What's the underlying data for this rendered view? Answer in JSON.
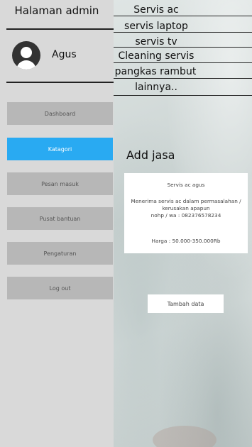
{
  "sidebar": {
    "title": "Halaman admin",
    "user_name": "Agus",
    "buttons": [
      {
        "label": "Dashboard"
      },
      {
        "label": "Katagori"
      },
      {
        "label": "Pesan masuk"
      },
      {
        "label": "Pusat bantuan"
      },
      {
        "label": "Pengaturan"
      },
      {
        "label": "Log out"
      }
    ],
    "active_index": 1
  },
  "category_menu": [
    "Servis ac",
    "servis laptop",
    "servis tv",
    "Cleaning servis",
    "pangkas rambut",
    "lainnya.."
  ],
  "main": {
    "heading": "Add jasa",
    "card": {
      "name": "Servis ac agus",
      "desc_line1": "Menerima servis ac dalam permasalahan /",
      "desc_line2": "kerusakan apapun",
      "contact": "nohp / wa : 082376578234",
      "price": "Harga : 50.000-350.000Rb"
    },
    "add_button_label": "Tambah data"
  },
  "colors": {
    "sidebar_bg": "#d9d9d9",
    "button_bg": "#b7b7b7",
    "active_accent": "#29aaf2"
  }
}
